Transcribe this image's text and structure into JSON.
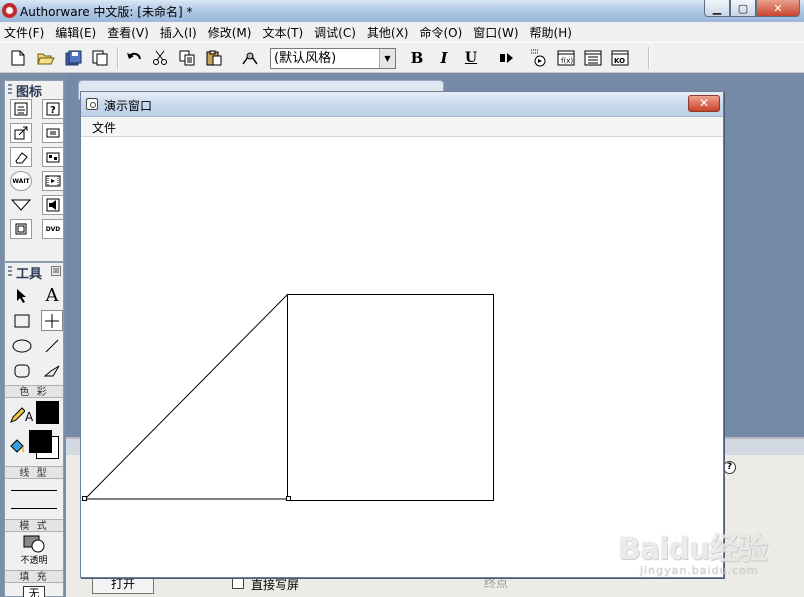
{
  "window": {
    "title": "Authorware 中文版: [未命名] *",
    "controls": {
      "minimize": "▁",
      "maximize": "▢",
      "close": "✕"
    }
  },
  "menubar": [
    "文件(F)",
    "编辑(E)",
    "查看(V)",
    "插入(I)",
    "修改(M)",
    "文本(T)",
    "调试(C)",
    "其他(X)",
    "命令(O)",
    "窗口(W)",
    "帮助(H)"
  ],
  "toolbar": {
    "style_select": "(默认风格)",
    "bold": "B",
    "italic": "I",
    "underline": "U"
  },
  "icons_palette": {
    "title": "图标",
    "items": [
      "display-icon",
      "interaction-icon",
      "calculation-icon",
      "move-icon",
      "erase-icon",
      "wait-icon",
      "decision-icon",
      "navigate-icon",
      "framework-icon",
      "digital-movie-icon",
      "sound-icon",
      "video-icon"
    ],
    "wait_text": "WAIT",
    "dvd_text": "DVD"
  },
  "tools_palette": {
    "title": "工具",
    "close": "⊠",
    "color_label": "色 彩",
    "line_label": "线 型",
    "mode_label": "模 式",
    "mode_value": "不透明",
    "fill_label": "填 充",
    "fill_value": "无",
    "text_tool": "A",
    "text_color_letter": "A"
  },
  "presentation": {
    "title": "演示窗口",
    "close": "✕",
    "menu": "文件"
  },
  "bottom_panel": {
    "open_button": "打开",
    "checkbox_label": "直接写屏",
    "grey_label": "终点",
    "help": "?"
  },
  "watermark": {
    "logo": "Baidu经验",
    "url": "jingyan.baidu.com"
  },
  "colors": {
    "workspace": "#758aa6",
    "close_button": "#c74329",
    "fill_color": "#000000"
  }
}
